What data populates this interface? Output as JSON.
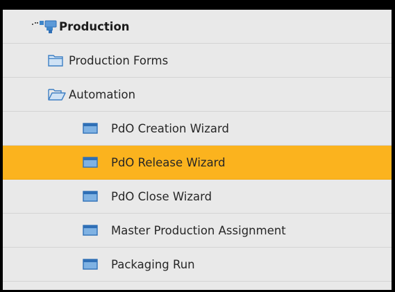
{
  "tree": {
    "root": {
      "label": "Production",
      "icon": "production-module-icon"
    },
    "folders": [
      {
        "label": "Production Forms",
        "icon": "folder-closed-icon"
      },
      {
        "label": "Automation",
        "icon": "folder-open-icon"
      }
    ],
    "items": [
      {
        "label": "PdO Creation Wizard",
        "icon": "window-form-icon",
        "selected": false
      },
      {
        "label": "PdO Release Wizard",
        "icon": "window-form-icon",
        "selected": true
      },
      {
        "label": "PdO Close Wizard",
        "icon": "window-form-icon",
        "selected": false
      },
      {
        "label": "Master Production Assignment",
        "icon": "window-form-icon",
        "selected": false
      },
      {
        "label": "Packaging Run",
        "icon": "window-form-icon",
        "selected": false
      }
    ]
  },
  "colors": {
    "selection": "#fbb31e",
    "panel_background": "#e9e9e9",
    "window_icon": "#2f6fb6",
    "folder_icon": "#3d7fc4",
    "frame_border": "#000000"
  }
}
